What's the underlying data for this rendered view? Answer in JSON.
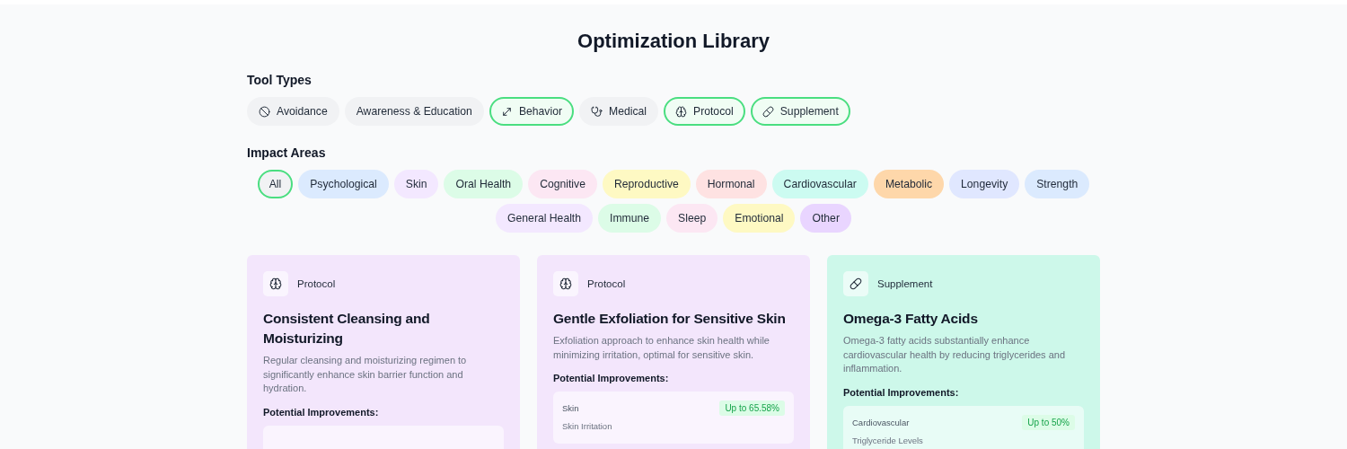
{
  "title": "Optimization Library",
  "tool_types": {
    "label": "Tool Types",
    "items": [
      {
        "label": "Avoidance",
        "kind": "ban",
        "selected": false
      },
      {
        "label": "Awareness & Education",
        "kind": "none",
        "selected": false
      },
      {
        "label": "Behavior",
        "kind": "arrows",
        "selected": true
      },
      {
        "label": "Medical",
        "kind": "stethoscope",
        "selected": false
      },
      {
        "label": "Protocol",
        "kind": "brain",
        "selected": true
      },
      {
        "label": "Supplement",
        "kind": "pill",
        "selected": true
      }
    ]
  },
  "impact_areas": {
    "label": "Impact Areas",
    "items": [
      {
        "label": "All",
        "selected": true,
        "color": "#f1f2f4"
      },
      {
        "label": "Psychological",
        "selected": false,
        "color": "#dbeafe"
      },
      {
        "label": "Skin",
        "selected": false,
        "color": "#f3e8ff"
      },
      {
        "label": "Oral Health",
        "selected": false,
        "color": "#dcfce7"
      },
      {
        "label": "Cognitive",
        "selected": false,
        "color": "#fce7f3"
      },
      {
        "label": "Reproductive",
        "selected": false,
        "color": "#fef9c3"
      },
      {
        "label": "Hormonal",
        "selected": false,
        "color": "#fee2e2"
      },
      {
        "label": "Cardiovascular",
        "selected": false,
        "color": "#ccfbf1"
      },
      {
        "label": "Metabolic",
        "selected": false,
        "color": "#fed7aa"
      },
      {
        "label": "Longevity",
        "selected": false,
        "color": "#e0e7ff"
      },
      {
        "label": "Strength",
        "selected": false,
        "color": "#dbeafe"
      },
      {
        "label": "General Health",
        "selected": false,
        "color": "#f3e8ff"
      },
      {
        "label": "Immune",
        "selected": false,
        "color": "#dcfce7"
      },
      {
        "label": "Sleep",
        "selected": false,
        "color": "#fce7f3"
      },
      {
        "label": "Emotional",
        "selected": false,
        "color": "#fef9c3"
      },
      {
        "label": "Other",
        "selected": false,
        "color": "#e9d5ff"
      }
    ]
  },
  "cards": [
    {
      "type": "Protocol",
      "kind": "brain",
      "color": "#f3e6fc",
      "title": "Consistent Cleansing and Moisturizing",
      "description": "Regular cleansing and moisturizing regimen to significantly enhance skin barrier function and hydration.",
      "improvements_label": "Potential Improvements:",
      "improvements_cut": true
    },
    {
      "type": "Protocol",
      "kind": "brain",
      "color": "#f3e6fc",
      "title": "Gentle Exfoliation for Sensitive Skin",
      "description": "Exfoliation approach to enhance skin health while minimizing irritation, optimal for sensitive skin.",
      "improvements_label": "Potential Improvements:",
      "improvements": [
        {
          "area": "Skin",
          "value": "Up to 65.58%",
          "metric": "Skin Irritation"
        }
      ]
    },
    {
      "type": "Supplement",
      "kind": "pill",
      "color": "#cdf8ea",
      "title": "Omega-3 Fatty Acids",
      "description": "Omega-3 fatty acids substantially enhance cardiovascular health by reducing triglycerides and inflammation.",
      "improvements_label": "Potential Improvements:",
      "improvements": [
        {
          "area": "Cardiovascular",
          "value": "Up to 50%",
          "metric": "Triglyceride Levels"
        }
      ]
    }
  ]
}
